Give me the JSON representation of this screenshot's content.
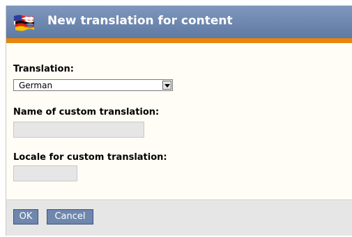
{
  "dialog": {
    "title": "New translation for content",
    "flag_icon": "us-german-flag-icon"
  },
  "form": {
    "translation_label": "Translation:",
    "translation_value": "German",
    "custom_name_label": "Name of custom translation:",
    "custom_name_value": "",
    "locale_label": "Locale for custom translation:",
    "locale_value": ""
  },
  "buttons": {
    "ok_label": "OK",
    "cancel_label": "Cancel"
  },
  "colors": {
    "titlebar": "#6f87ad",
    "accent_bar": "#e8860a",
    "button": "#6f87ad"
  }
}
